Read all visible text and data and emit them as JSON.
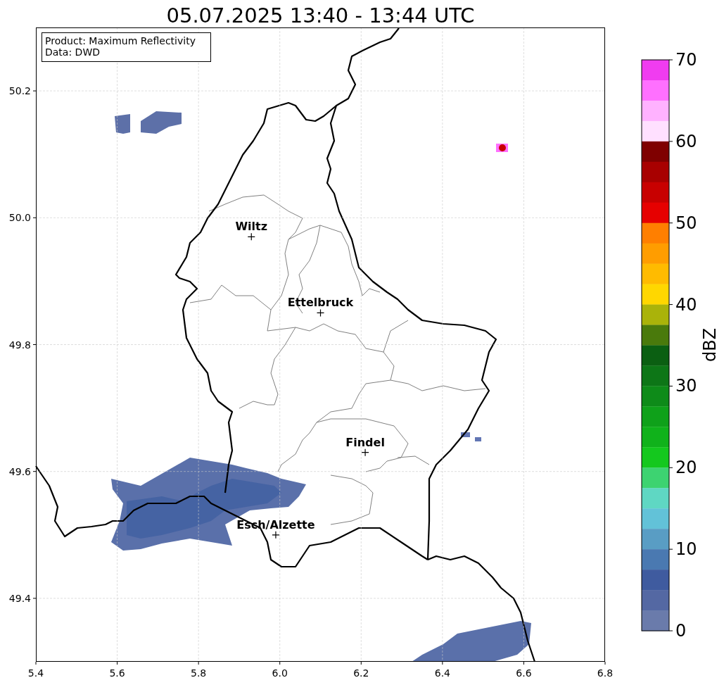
{
  "figure": {
    "legend": [
      "Product: Maximum Reflectivity",
      "Data: DWD"
    ],
    "chart_data": {
      "type": "scatter",
      "title": "05.07.2025 13:40 - 13:44 UTC",
      "x": [
        5.93,
        6.1,
        6.21,
        5.99
      ],
      "series": [
        {
          "color": "#000000",
          "values": [
            49.97,
            49.85,
            49.63,
            49.5
          ]
        }
      ],
      "xlim": [
        5.4,
        6.8
      ],
      "ylim": [
        49.3,
        50.3
      ],
      "grid": true,
      "xticks": [
        {
          "value": 5.4,
          "label": "5.4"
        },
        {
          "value": 5.6,
          "label": "5.6"
        },
        {
          "value": 5.8,
          "label": "5.8"
        },
        {
          "value": 6.0,
          "label": "6.0"
        },
        {
          "value": 6.2,
          "label": "6.2"
        },
        {
          "value": 6.4,
          "label": "6.4"
        },
        {
          "value": 6.6,
          "label": "6.6"
        },
        {
          "value": 6.8,
          "label": "6.8"
        }
      ],
      "yticks": [
        {
          "value": 50.2,
          "label": "50.2"
        },
        {
          "value": 50.0,
          "label": "50.0"
        },
        {
          "value": 49.8,
          "label": "49.8"
        },
        {
          "value": 49.6,
          "label": "49.6"
        },
        {
          "value": 49.4,
          "label": "49.4"
        }
      ],
      "annotations": [
        {
          "text": "Wiltz",
          "x": 5.93,
          "y": 49.97
        },
        {
          "text": "Ettelbruck",
          "x": 6.1,
          "y": 49.85
        },
        {
          "text": "Findel",
          "x": 6.21,
          "y": 49.63
        },
        {
          "text": "Esch/Alzette",
          "x": 5.99,
          "y": 49.5
        }
      ]
    }
  },
  "colorbar": {
    "label": "dBZ",
    "ticks": [
      "70",
      "60",
      "50",
      "40",
      "30",
      "20",
      "10",
      "0"
    ],
    "segments": [
      {
        "color": "#f03cf0"
      },
      {
        "color": "#ff70ff"
      },
      {
        "color": "#ffb2ff"
      },
      {
        "color": "#ffe0ff"
      },
      {
        "color": "#7f0000"
      },
      {
        "color": "#a80000"
      },
      {
        "color": "#c80000"
      },
      {
        "color": "#e60000"
      },
      {
        "color": "#ff7f00"
      },
      {
        "color": "#ff9d00"
      },
      {
        "color": "#ffbb00"
      },
      {
        "color": "#ffd700"
      },
      {
        "color": "#aab30a"
      },
      {
        "color": "#4a7a0c"
      },
      {
        "color": "#0b5f12"
      },
      {
        "color": "#0d7617"
      },
      {
        "color": "#0e8b19"
      },
      {
        "color": "#0fa11a"
      },
      {
        "color": "#10b21b"
      },
      {
        "color": "#14c81e"
      },
      {
        "color": "#3dd371"
      },
      {
        "color": "#5fd7c3"
      },
      {
        "color": "#62c2d8"
      },
      {
        "color": "#599dc4"
      },
      {
        "color": "#4a79b1"
      },
      {
        "color": "#3f5b9f"
      },
      {
        "color": "#5468a3"
      },
      {
        "color": "#6a7bab"
      }
    ]
  }
}
